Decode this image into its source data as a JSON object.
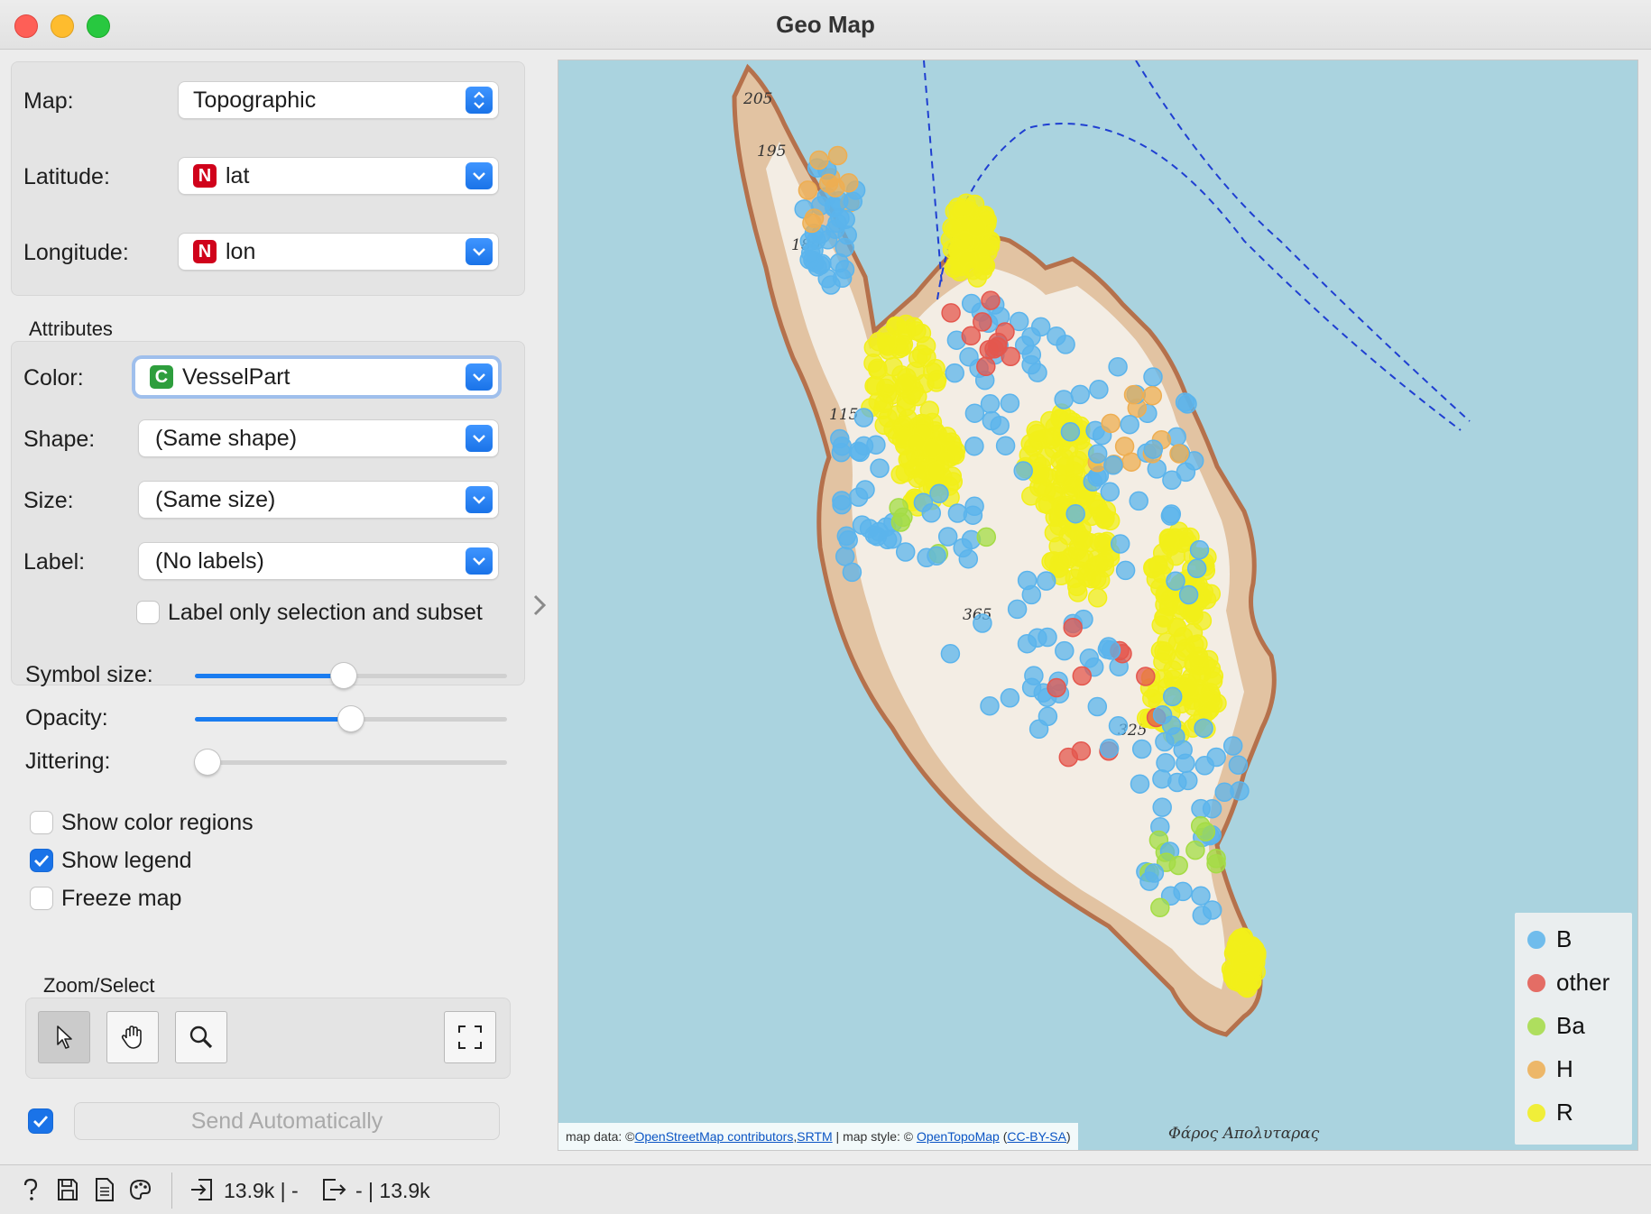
{
  "window": {
    "title": "Geo Map"
  },
  "controls": {
    "map_label": "Map:",
    "map_value": "Topographic",
    "latitude_label": "Latitude:",
    "latitude_type": "N",
    "latitude_value": "lat",
    "longitude_label": "Longitude:",
    "longitude_type": "N",
    "longitude_value": "lon",
    "attributes_title": "Attributes",
    "color_label": "Color:",
    "color_type": "C",
    "color_value": "VesselPart",
    "shape_label": "Shape:",
    "shape_value": "(Same shape)",
    "size_label": "Size:",
    "size_value": "(Same size)",
    "label_label": "Label:",
    "label_value": "(No labels)",
    "label_only_selection": "Label only selection and subset",
    "symbol_size_label": "Symbol size:",
    "opacity_label": "Opacity:",
    "jittering_label": "Jittering:",
    "show_color_regions": "Show color regions",
    "show_legend": "Show legend",
    "freeze_map": "Freeze map",
    "zoom_select_title": "Zoom/Select",
    "send_automatically": "Send Automatically"
  },
  "sliders": {
    "symbol_size": 0.48,
    "opacity": 0.5,
    "jittering": 0.0
  },
  "checkboxes": {
    "label_only_selection": false,
    "show_color_regions": false,
    "show_legend": true,
    "freeze_map": false,
    "send_automatically": true
  },
  "map": {
    "legend": [
      {
        "label": "B",
        "color": "#5bb4ec"
      },
      {
        "label": "other",
        "color": "#e4574e"
      },
      {
        "label": "Ba",
        "color": "#a4dc45"
      },
      {
        "label": "H",
        "color": "#eeae52"
      },
      {
        "label": "R",
        "color": "#f2ef1a"
      }
    ],
    "attribution_prefix": "map data: © ",
    "attribution_osm": "OpenStreetMap contributors",
    "attribution_srtm": "SRTM",
    "attribution_style": " | map style: © ",
    "attribution_opentopo": "OpenTopoMap",
    "attribution_license": "CC-BY-SA",
    "elevations": [
      "205",
      "195",
      "180",
      "115",
      "365",
      "325"
    ],
    "place_name": "Φάρος Απολυταρας"
  },
  "status": {
    "input_count": "13.9k | -",
    "output_count": "- | 13.9k"
  },
  "icons": [
    "help-icon",
    "save-icon",
    "report-icon",
    "visual-settings-icon",
    "input-icon",
    "output-icon",
    "pointer-icon",
    "hand-icon",
    "zoom-icon",
    "fit-icon"
  ]
}
